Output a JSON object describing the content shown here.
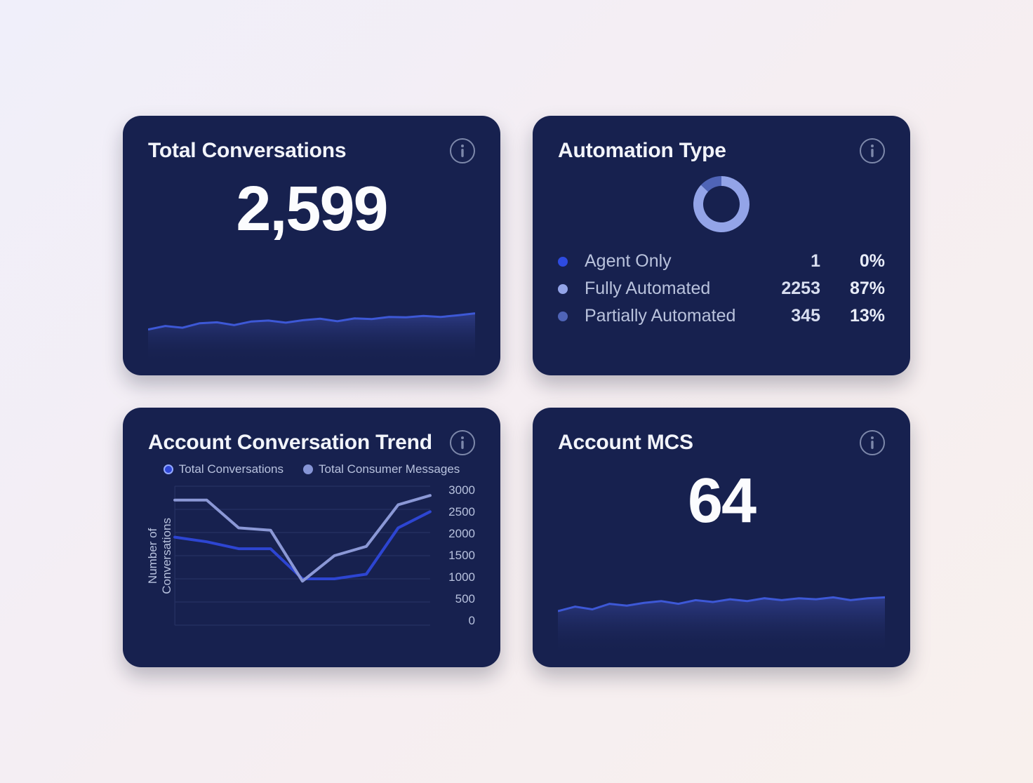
{
  "cards": {
    "total_conversations": {
      "title": "Total Conversations",
      "value": "2,599"
    },
    "automation_type": {
      "title": "Automation Type",
      "rows": [
        {
          "label": "Agent Only",
          "count": "1",
          "pct": "0%",
          "color": "#2e4be0"
        },
        {
          "label": "Fully Automated",
          "count": "2253",
          "pct": "87%",
          "color": "#93a4e8"
        },
        {
          "label": "Partially Automated",
          "count": "345",
          "pct": "13%",
          "color": "#4f64b7"
        }
      ]
    },
    "account_trend": {
      "title": "Account Conversation Trend",
      "legend": [
        "Total Conversations",
        "Total Consumer Messages"
      ],
      "y_axis_label": "Number of\nConversations",
      "y_ticks": [
        "3000",
        "2500",
        "2000",
        "1500",
        "1000",
        "500",
        "0"
      ]
    },
    "account_mcs": {
      "title": "Account MCS",
      "value": "64"
    }
  },
  "colors": {
    "card_bg": "#17214f",
    "spark_line": "#3d58d6",
    "spark_fill_top": "#2f3d8a",
    "spark_fill_bottom": "#17214f",
    "trend_line_a": "#2d45d2",
    "trend_line_b": "#8b98d6",
    "axis": "#7d88aa"
  },
  "chart_data": [
    {
      "id": "total_conversations_sparkline",
      "type": "area",
      "title": "Total Conversations",
      "x": [
        0,
        1,
        2,
        3,
        4,
        5,
        6,
        7,
        8,
        9,
        10,
        11,
        12,
        13,
        14,
        15,
        16,
        17,
        18,
        19
      ],
      "values": [
        2520,
        2540,
        2530,
        2555,
        2560,
        2545,
        2565,
        2570,
        2558,
        2572,
        2580,
        2566,
        2582,
        2578,
        2590,
        2588,
        2596,
        2590,
        2599,
        2610
      ],
      "ylim": [
        2400,
        2700
      ]
    },
    {
      "id": "automation_type_donut",
      "type": "pie",
      "title": "Automation Type",
      "series": [
        {
          "name": "Agent Only",
          "value": 1,
          "pct": 0,
          "color": "#2e4be0"
        },
        {
          "name": "Fully Automated",
          "value": 2253,
          "pct": 87,
          "color": "#93a4e8"
        },
        {
          "name": "Partially Automated",
          "value": 345,
          "pct": 13,
          "color": "#4f64b7"
        }
      ]
    },
    {
      "id": "account_conversation_trend",
      "type": "line",
      "title": "Account Conversation Trend",
      "ylabel": "Number of Conversations",
      "ylim": [
        0,
        3000
      ],
      "x": [
        0,
        1,
        2,
        3,
        4,
        5,
        6,
        7,
        8
      ],
      "series": [
        {
          "name": "Total Conversations",
          "color": "#2d45d2",
          "values": [
            1900,
            1800,
            1650,
            1650,
            1000,
            1000,
            1100,
            2100,
            2450
          ]
        },
        {
          "name": "Total Consumer Messages",
          "color": "#8b98d6",
          "values": [
            2700,
            2700,
            2100,
            2050,
            950,
            1500,
            1700,
            2600,
            2800
          ]
        }
      ]
    },
    {
      "id": "account_mcs_sparkline",
      "type": "area",
      "title": "Account MCS",
      "x": [
        0,
        1,
        2,
        3,
        4,
        5,
        6,
        7,
        8,
        9,
        10,
        11,
        12,
        13,
        14,
        15,
        16,
        17,
        18,
        19
      ],
      "values": [
        63,
        63.5,
        63.2,
        63.8,
        63.6,
        63.9,
        64.1,
        63.8,
        64.2,
        64.0,
        64.3,
        64.1,
        64.4,
        64.2,
        64.4,
        64.3,
        64.5,
        64.2,
        64.4,
        64.5
      ],
      "ylim": [
        60,
        68
      ]
    }
  ]
}
